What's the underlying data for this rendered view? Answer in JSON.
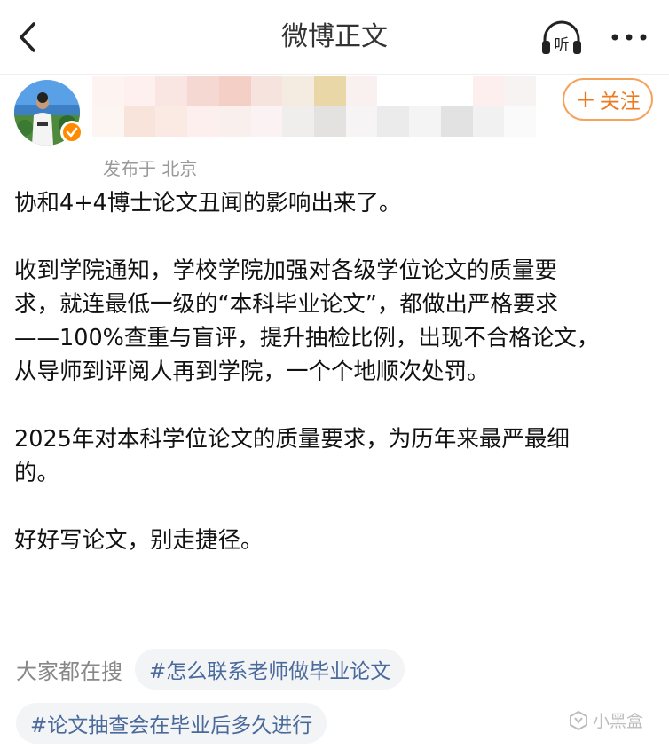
{
  "topbar": {
    "title": "微博正文",
    "listen_label": "听",
    "back_icon": "chevron-left-icon",
    "more_icon": "ellipsis-icon"
  },
  "post": {
    "location": "发布于 北京",
    "follow_label": "关注",
    "follow_plus": "+",
    "accent_color": "#ee7a20",
    "body": {
      "line1": "协和4+4博士论文丑闻的影响出来了。",
      "line2": "收到学院通知，学校学院加强对各级学位论文的质量要",
      "line3": "求，就连最低一级的“本科毕业论文”，都做出严格要求",
      "line4": "——100%查重与盲评，提升抽检比例，出现不合格论文，",
      "line5": "从导师到评阅人再到学院，一个个地顺次处罚。",
      "line6": "2025年对本科学位论文的质量要求，为历年来最严最细",
      "line7": "的。",
      "line8": "好好写论文，别走捷径。"
    }
  },
  "search": {
    "label": "大家都在搜",
    "tags": [
      "#怎么联系老师做毕业论文",
      "#论文抽查会在毕业后多久进行"
    ],
    "tag_color": "#4a6a9c"
  },
  "watermark": {
    "text": "小黑盒"
  }
}
